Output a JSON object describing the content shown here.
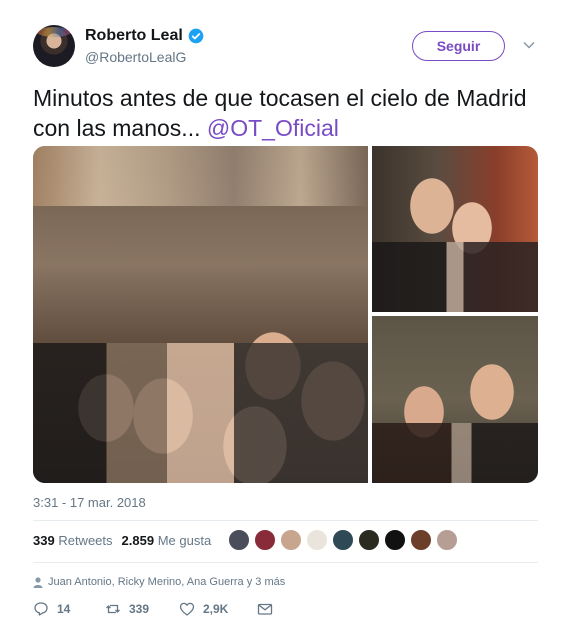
{
  "header": {
    "display_name": "Roberto Leal",
    "handle": "@RobertoLealG",
    "verified_icon": "verified-badge-icon",
    "follow_label": "Seguir",
    "menu_icon": "chevron-down-icon"
  },
  "tweet": {
    "text": "Minutos antes de que tocasen el cielo de Madrid con las manos... ",
    "mention": "@OT_Oficial",
    "timestamp": "3:31 - 17 mar. 2018"
  },
  "media": {
    "photo_count": 3
  },
  "stats": {
    "retweets_count": "339",
    "retweets_label": "Retweets",
    "likes_count": "2.859",
    "likes_label": "Me gusta",
    "liker_avatars": [
      "#4a4d5a",
      "#8a2b3a",
      "#c8a58e",
      "#e9e4dc",
      "#2f4a56",
      "#2b2b22",
      "#111111",
      "#6b3f2a",
      "#b69e95"
    ]
  },
  "liked_by": {
    "text": "Juan Antonio, Ricky Merino, Ana Guerra y 3 más"
  },
  "actions": {
    "replies": "14",
    "retweets": "339",
    "likes": "2,9K"
  },
  "colors": {
    "accent": "#794bc4",
    "secondary_text": "#657786",
    "verified": "#1da1f2"
  }
}
